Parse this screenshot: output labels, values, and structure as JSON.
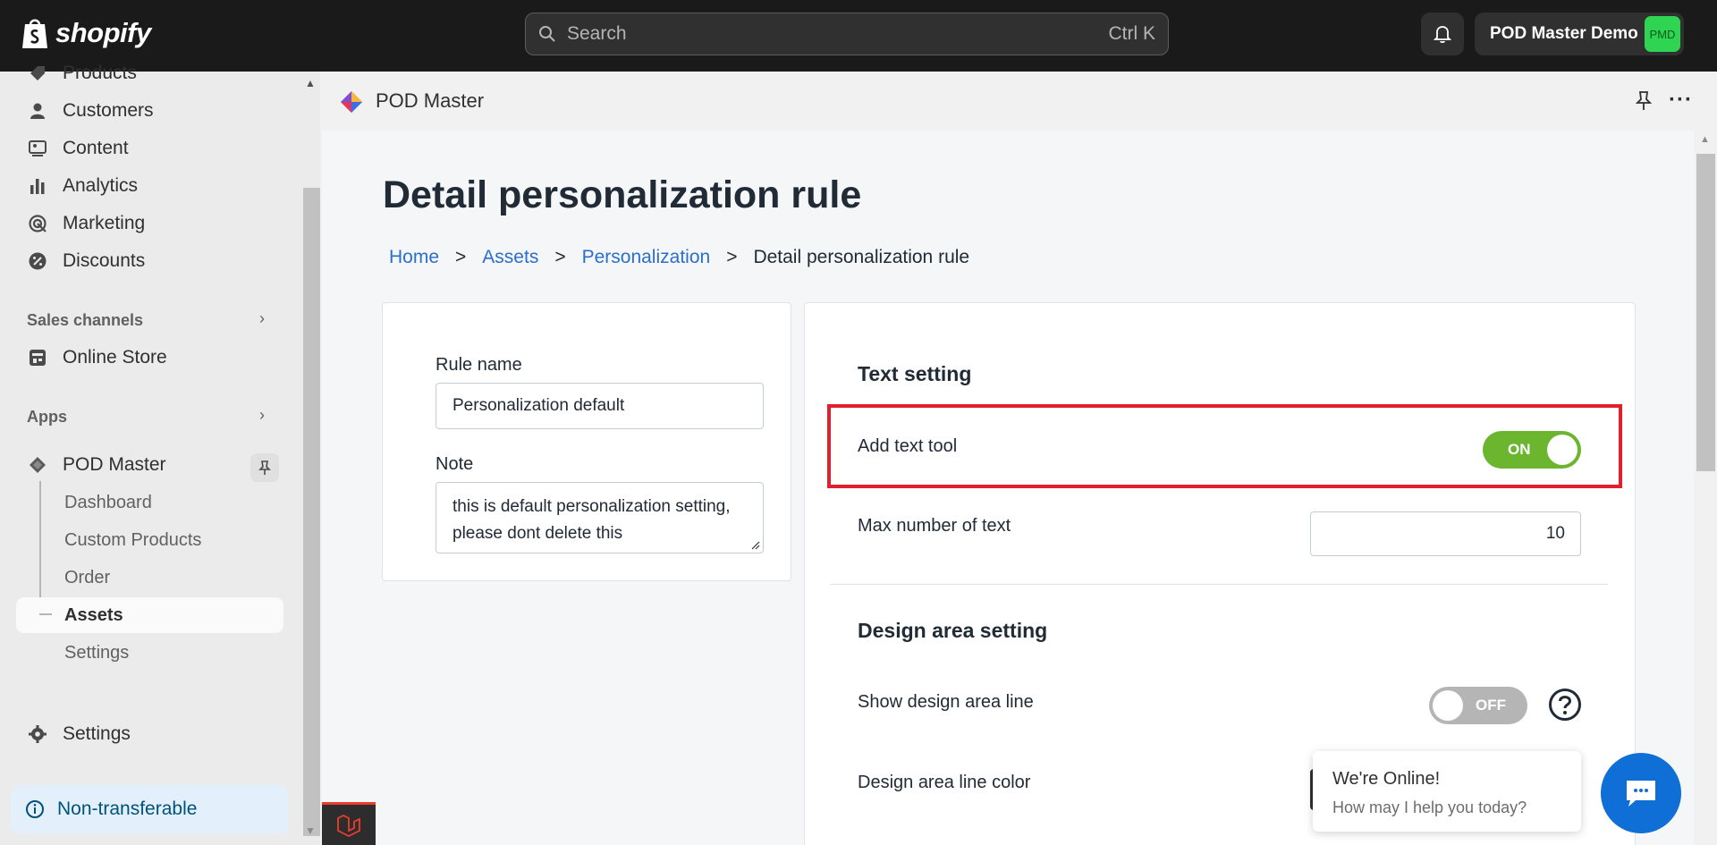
{
  "topbar": {
    "brand": "shopify",
    "search_placeholder": "Search",
    "search_shortcut": "Ctrl K",
    "store_name": "POD Master Demo",
    "store_initials": "PMD"
  },
  "sidebar": {
    "items": [
      {
        "label": "Products",
        "icon": "tag-icon"
      },
      {
        "label": "Customers",
        "icon": "person-icon"
      },
      {
        "label": "Content",
        "icon": "image-icon"
      },
      {
        "label": "Analytics",
        "icon": "bar-chart-icon"
      },
      {
        "label": "Marketing",
        "icon": "target-icon"
      },
      {
        "label": "Discounts",
        "icon": "discount-icon"
      }
    ],
    "sales_channels_label": "Sales channels",
    "online_store_label": "Online Store",
    "apps_label": "Apps",
    "app_name": "POD Master",
    "app_sub_items": [
      "Dashboard",
      "Custom Products",
      "Order",
      "Assets",
      "Settings"
    ],
    "settings_label": "Settings",
    "non_transferable_label": "Non-transferable"
  },
  "app_header": {
    "title": "POD Master"
  },
  "page": {
    "title": "Detail personalization rule",
    "breadcrumb": {
      "home": "Home",
      "assets": "Assets",
      "personalization": "Personalization",
      "current": "Detail personalization rule",
      "separator": ">"
    }
  },
  "rule_form": {
    "rule_name_label": "Rule name",
    "rule_name_value": "Personalization default",
    "note_label": "Note",
    "note_value": "this is default personalization setting, please dont delete this"
  },
  "text_setting": {
    "title": "Text setting",
    "add_text_tool_label": "Add text tool",
    "add_text_tool_state": "ON",
    "max_text_label": "Max number of text",
    "max_text_value": "10"
  },
  "design_area": {
    "title": "Design area setting",
    "show_line_label": "Show design area line",
    "show_line_state": "OFF",
    "line_color_label": "Design area line color"
  },
  "chat": {
    "title": "We're Online!",
    "subtitle": "How may I help you today?"
  },
  "colors": {
    "accent_link": "#2c6ecb",
    "toggle_on": "#6bb52f",
    "highlight": "#e0202c",
    "chat_button": "#0f6fd6"
  }
}
